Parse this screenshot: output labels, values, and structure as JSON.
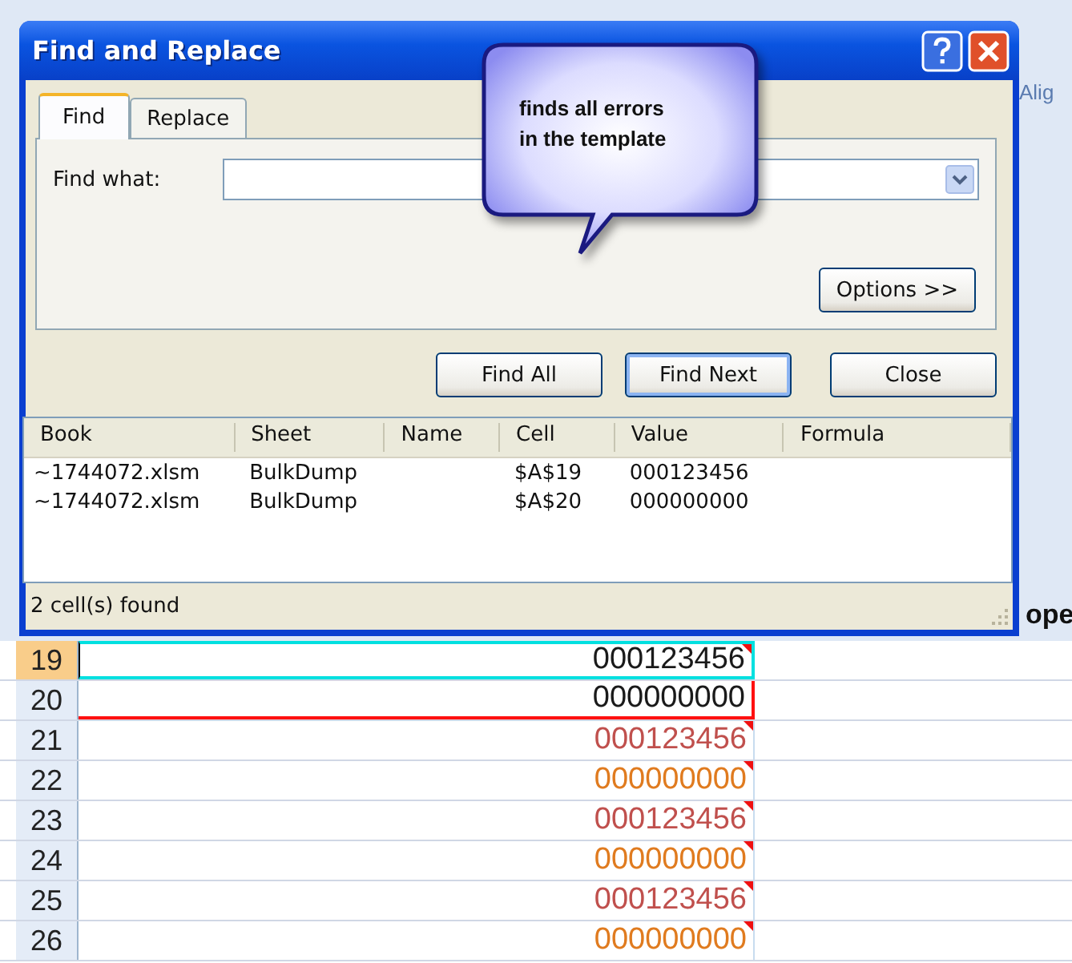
{
  "window": {
    "title": "Find and Replace"
  },
  "background_labels": {
    "ribbon_group": "Alig",
    "column_header": "ope"
  },
  "tabs": [
    {
      "label": "Find",
      "selected": true
    },
    {
      "label": "Replace",
      "selected": false
    }
  ],
  "find_what": {
    "label": "Find what:"
  },
  "options_button": {
    "label": "Options >>"
  },
  "buttons": [
    {
      "label": "Find All",
      "default": false
    },
    {
      "label": "Find Next",
      "default": true
    },
    {
      "label": "Close",
      "default": false
    }
  ],
  "results": {
    "columns": [
      "Book",
      "Sheet",
      "Name",
      "Cell",
      "Value",
      "Formula"
    ],
    "rows": [
      [
        "~1744072.xlsm",
        "BulkDump",
        "",
        "$A$19",
        "000123456",
        ""
      ],
      [
        "~1744072.xlsm",
        "BulkDump",
        "",
        "$A$20",
        "000000000",
        ""
      ]
    ]
  },
  "status_bar": "2 cell(s) found",
  "callout": {
    "text": "finds all errors\nin the template"
  },
  "sheet_rows": [
    {
      "number": "19",
      "value": "000123456",
      "color": "#1a1a1a",
      "selected": true,
      "outlined": false,
      "error_marker": true
    },
    {
      "number": "20",
      "value": "000000000",
      "color": "#1a1a1a",
      "selected": false,
      "outlined": true,
      "error_marker": false
    },
    {
      "number": "21",
      "value": "000123456",
      "color": "#c0504d",
      "selected": false,
      "outlined": false,
      "error_marker": true
    },
    {
      "number": "22",
      "value": "000000000",
      "color": "#e07b1f",
      "selected": false,
      "outlined": false,
      "error_marker": true
    },
    {
      "number": "23",
      "value": "000123456",
      "color": "#c0504d",
      "selected": false,
      "outlined": false,
      "error_marker": true
    },
    {
      "number": "24",
      "value": "000000000",
      "color": "#e07b1f",
      "selected": false,
      "outlined": false,
      "error_marker": true
    },
    {
      "number": "25",
      "value": "000123456",
      "color": "#c0504d",
      "selected": false,
      "outlined": false,
      "error_marker": true
    },
    {
      "number": "26",
      "value": "000000000",
      "color": "#e07b1f",
      "selected": false,
      "outlined": false,
      "error_marker": true
    }
  ]
}
